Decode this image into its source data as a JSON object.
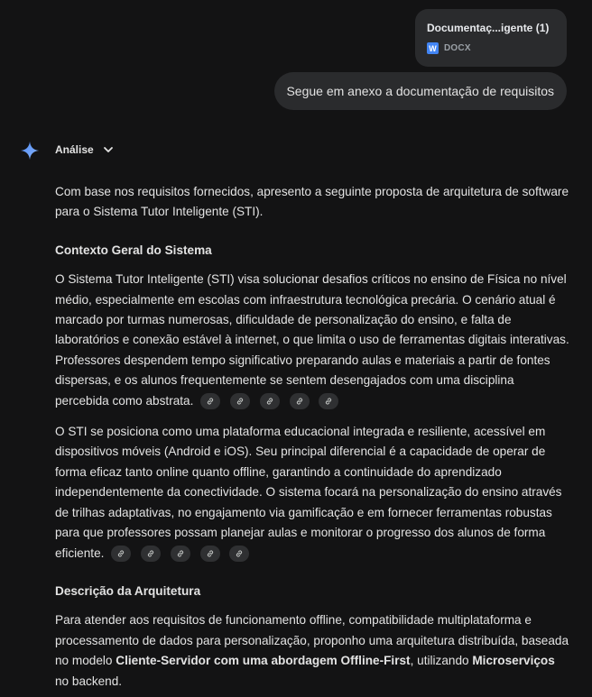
{
  "attachment": {
    "name": "Documentaç...igente (1)",
    "type_label": "DOCX",
    "icon": "word-doc-icon"
  },
  "user_message": "Segue em anexo a documentação de requisitos",
  "response": {
    "header": {
      "label": "Análise",
      "icon": "sparkle-icon",
      "toggle_icon": "chevron-down-icon"
    },
    "intro": "Com base nos requisitos fornecidos, apresento a seguinte proposta de arquitetura de software para o Sistema Tutor Inteligente (STI).",
    "section1_title": "Contexto Geral do Sistema",
    "section1_p1": "O Sistema Tutor Inteligente (STI) visa solucionar desafios críticos no ensino de Física no nível médio, especialmente em escolas com infraestrutura tecnológica precária. O cenário atual é marcado por turmas numerosas, dificuldade de personalização do ensino, e falta de laboratórios e conexão estável à internet, o que limita o uso de ferramentas digitais interativas. Professores despendem tempo significativo preparando aulas e materiais a partir de fontes dispersas, e os alunos frequentemente se sentem desengajados com uma disciplina percebida como abstrata.",
    "section1_p2": "O STI se posiciona como uma plataforma educacional integrada e resiliente, acessível em dispositivos móveis (Android e iOS). Seu principal diferencial é a capacidade de operar de forma eficaz tanto online quanto offline, garantindo a continuidade do aprendizado independentemente da conectividade. O sistema focará na personalização do ensino através de trilhas adaptativas, no engajamento via gamificação e em fornecer ferramentas robustas para que professores possam planejar aulas e monitorar o progresso dos alunos de forma eficiente.",
    "section2_title": "Descrição da Arquitetura",
    "section2_p1_a": "Para atender aos requisitos de funcionamento offline, compatibilidade multiplataforma e processamento de dados para personalização, proponho uma arquitetura distribuída, baseada no modelo ",
    "section2_p1_b": "Cliente-Servidor com uma abordagem Offline-First",
    "section2_p1_c": ", utilizando ",
    "section2_p1_d": "Microserviços",
    "section2_p1_e": " no backend."
  }
}
